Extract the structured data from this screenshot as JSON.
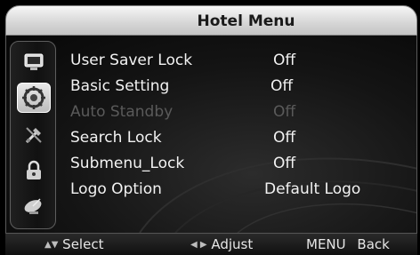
{
  "title": "Hotel Menu",
  "sidebar": {
    "icons": [
      {
        "name": "picture-icon"
      },
      {
        "name": "settings-gear-icon",
        "selected": true
      },
      {
        "name": "tools-icon"
      },
      {
        "name": "lock-icon"
      },
      {
        "name": "satellite-dish-icon"
      }
    ]
  },
  "menu": {
    "items": [
      {
        "label": "User Saver Lock",
        "value": "Off"
      },
      {
        "label": "Basic Setting",
        "value": "Off"
      },
      {
        "label": "Auto Standby",
        "value": "Off",
        "disabled": true
      },
      {
        "label": "Search Lock",
        "value": "Off"
      },
      {
        "label": "Submenu_Lock",
        "value": "Off"
      },
      {
        "label": "Logo Option",
        "value": "Default Logo"
      }
    ]
  },
  "help": {
    "select": "Select",
    "adjust": "Adjust",
    "menu_key": "MENU",
    "back": "Back"
  },
  "colors": {
    "text": "#f2f2f2",
    "disabled_text": "#5a5a5a",
    "title_text": "#1a1a1a"
  }
}
